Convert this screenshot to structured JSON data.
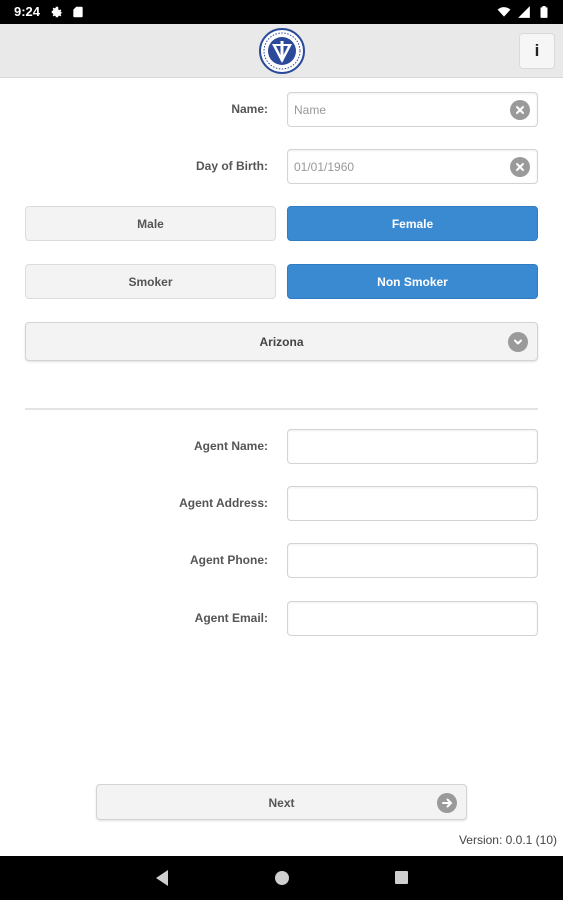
{
  "status_bar": {
    "time": "9:24",
    "left_icons": [
      "settings-icon",
      "sd-card-icon"
    ],
    "right_icons": [
      "wifi-icon",
      "signal-icon",
      "battery-icon"
    ]
  },
  "header": {
    "logo": "seal-logo",
    "info_label": "i"
  },
  "form": {
    "name": {
      "label": "Name:",
      "value": "",
      "placeholder": "Name"
    },
    "dob": {
      "label": "Day of Birth:",
      "value": "",
      "placeholder": "01/01/1960"
    },
    "gender": {
      "options": [
        "Male",
        "Female"
      ],
      "selected": "Female"
    },
    "smoker": {
      "options": [
        "Smoker",
        "Non Smoker"
      ],
      "selected": "Non Smoker"
    },
    "state": {
      "selected": "Arizona"
    }
  },
  "agent": {
    "name_label": "Agent Name:",
    "address_label": "Agent Address:",
    "phone_label": "Agent Phone:",
    "email_label": "Agent Email:",
    "name_value": "",
    "address_value": "",
    "phone_value": "",
    "email_value": ""
  },
  "next_label": "Next",
  "version_text": "Version: 0.0.1 (10)",
  "colors": {
    "accent": "#3a8ad2",
    "header_bg": "#e9e9e9",
    "icon_gray": "#9a9a9a"
  },
  "nav_bar": [
    "back-icon",
    "home-icon",
    "recents-icon"
  ]
}
